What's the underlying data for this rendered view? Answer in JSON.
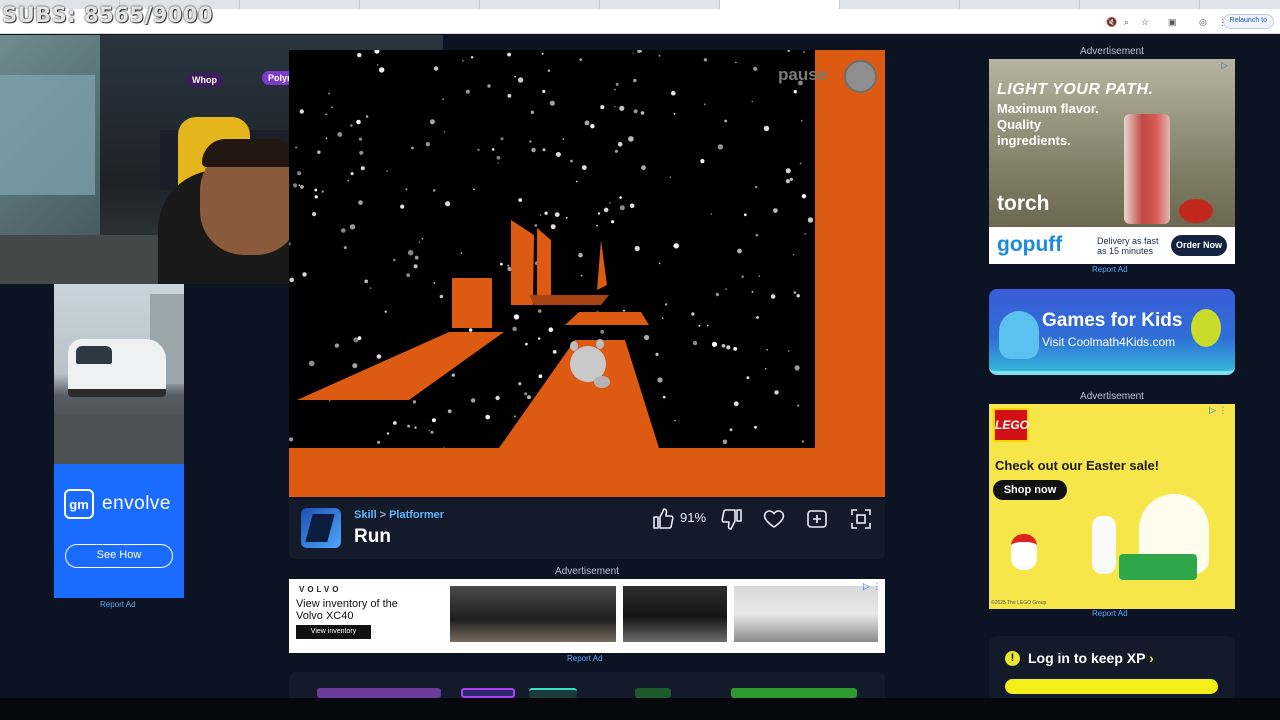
{
  "overlay": {
    "subs": "SUBS: 8565/9000"
  },
  "browser": {
    "relaunch": "Relaunch to",
    "icons": [
      "mute-icon",
      "zoom-icon",
      "star-icon",
      "extensions-icon",
      "profile-icon",
      "menu-icon"
    ]
  },
  "webcam": {
    "neon_1": "Whop",
    "neon_2": "Polymarket"
  },
  "left_ad": {
    "brand": "envolve",
    "logo": "gm",
    "cta": "See How",
    "report": "Report Ad"
  },
  "game": {
    "pause_label": "pause",
    "category": "Skill",
    "subcategory": "Platformer",
    "title": "Run",
    "rating": "91%",
    "colors": {
      "platform": "#dd5a13",
      "space": "#000000"
    }
  },
  "bottom_ad": {
    "label": "Advertisement",
    "logo": "VOLVO",
    "headline": "View inventory of the Volvo XC40",
    "cta": "View inventory",
    "report": "Report Ad"
  },
  "right_ads": {
    "label_top": "Advertisement",
    "torch": {
      "headline": "LIGHT YOUR PATH.",
      "sub": "Maximum flavor. Quality ingredients.",
      "brand": "torch",
      "partner": "gopuff",
      "delivery": "Delivery as fast as 15 minutes",
      "cta": "Order Now",
      "report": "Report Ad"
    },
    "kids": {
      "title": "Games for Kids",
      "subtitle": "Visit Coolmath4Kids.com"
    },
    "label_mid": "Advertisement",
    "lego": {
      "logo": "LEGO",
      "headline": "Check out our Easter sale!",
      "cta": "Shop now",
      "copyright": "©2025 The LEGO Group",
      "report": "Report Ad"
    }
  },
  "login": {
    "text": "Log in to keep XP",
    "chevron": "›"
  }
}
